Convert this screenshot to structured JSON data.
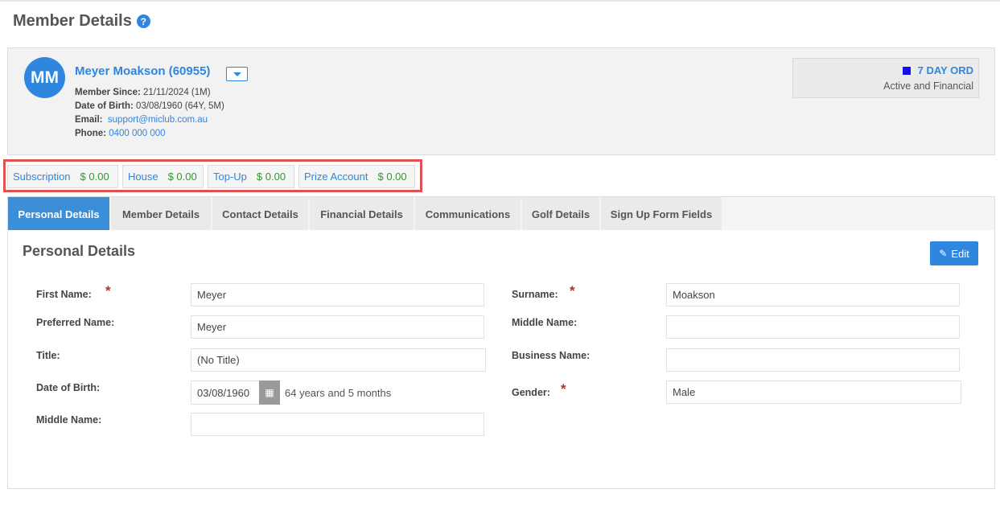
{
  "page": {
    "title": "Member Details",
    "help_icon": "?"
  },
  "member": {
    "initials": "MM",
    "name": "Meyer Moakson (60955)",
    "since_label": "Member Since:",
    "since_value": "21/11/2024 (1M)",
    "dob_label": "Date of Birth:",
    "dob_value": "03/08/1960 (64Y, 5M)",
    "email_label": "Email:",
    "email_value": "support@miclub.com.au",
    "phone_label": "Phone:",
    "phone_value": "0400 000 000"
  },
  "status": {
    "type": "7 DAY ORD",
    "text": "Active and Financial",
    "square_color": "#1010ee"
  },
  "balances": [
    {
      "label": "Subscription",
      "amount": "$ 0.00"
    },
    {
      "label": "House",
      "amount": "$ 0.00"
    },
    {
      "label": "Top-Up",
      "amount": "$ 0.00"
    },
    {
      "label": "Prize Account",
      "amount": "$ 0.00"
    }
  ],
  "tabs": [
    {
      "label": "Personal Details",
      "active": true
    },
    {
      "label": "Member Details",
      "active": false
    },
    {
      "label": "Contact Details",
      "active": false
    },
    {
      "label": "Financial Details",
      "active": false
    },
    {
      "label": "Communications",
      "active": false
    },
    {
      "label": "Golf Details",
      "active": false
    },
    {
      "label": "Sign Up Form Fields",
      "active": false
    }
  ],
  "section": {
    "title": "Personal Details",
    "edit_label": "Edit"
  },
  "fields": {
    "first_name": {
      "label": "First Name:",
      "value": "Meyer",
      "required": "*"
    },
    "preferred_name": {
      "label": "Preferred Name:",
      "value": "Meyer"
    },
    "title": {
      "label": "Title:",
      "value": "(No Title)"
    },
    "date_of_birth": {
      "label": "Date of Birth:",
      "value": "03/08/1960",
      "age": "64 years and 5 months"
    },
    "middle_name_left": {
      "label": "Middle Name:",
      "value": ""
    },
    "surname": {
      "label": "Surname:",
      "value": "Moakson",
      "required": "*"
    },
    "middle_name": {
      "label": "Middle Name:",
      "value": ""
    },
    "business_name": {
      "label": "Business Name:",
      "value": ""
    },
    "gender": {
      "label": "Gender:",
      "value": "Male",
      "required": "*"
    }
  },
  "colors": {
    "accent": "#2e86de",
    "amount_green": "#2e9a2e",
    "highlight_red": "#e05252",
    "required_red": "#aa3333"
  }
}
